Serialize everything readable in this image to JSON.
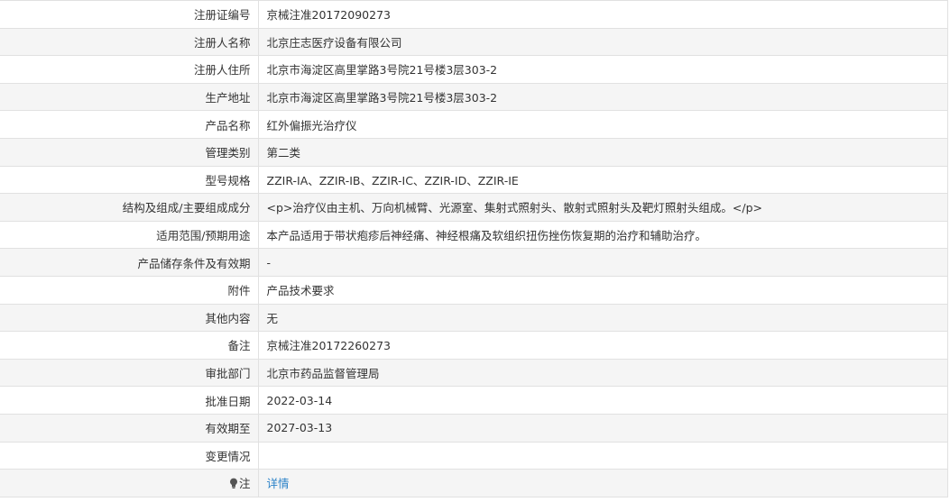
{
  "rows": [
    {
      "label": "注册证编号",
      "value": "京械注准20172090273"
    },
    {
      "label": "注册人名称",
      "value": "北京庄志医疗设备有限公司"
    },
    {
      "label": "注册人住所",
      "value": "北京市海淀区高里掌路3号院21号楼3层303-2"
    },
    {
      "label": "生产地址",
      "value": "北京市海淀区高里掌路3号院21号楼3层303-2"
    },
    {
      "label": "产品名称",
      "value": "红外偏振光治疗仪"
    },
    {
      "label": "管理类别",
      "value": "第二类"
    },
    {
      "label": "型号规格",
      "value": "ZZIR-IA、ZZIR-IB、ZZIR-IC、ZZIR-ID、ZZIR-IE"
    },
    {
      "label": "结构及组成/主要组成成分",
      "value": "<p>治疗仪由主机、万向机械臂、光源室、集射式照射头、散射式照射头及靶灯照射头组成。</p>"
    },
    {
      "label": "适用范围/预期用途",
      "value": "本产品适用于带状疱疹后神经痛、神经根痛及软组织扭伤挫伤恢复期的治疗和辅助治疗。"
    },
    {
      "label": "产品储存条件及有效期",
      "value": "-"
    },
    {
      "label": "附件",
      "value": "产品技术要求"
    },
    {
      "label": "其他内容",
      "value": "无"
    },
    {
      "label": "备注",
      "value": "京械注准20172260273"
    },
    {
      "label": "审批部门",
      "value": "北京市药品监督管理局"
    },
    {
      "label": "批准日期",
      "value": "2022-03-14"
    },
    {
      "label": "有效期至",
      "value": "2027-03-13"
    },
    {
      "label": "变更情况",
      "value": ""
    }
  ],
  "note_row": {
    "icon": "lightbulb-icon",
    "label": "注",
    "link_text": "详情"
  },
  "colors": {
    "link": "#2b82c8",
    "border": "#e1e1e1",
    "stripe": "#f5f5f5"
  }
}
